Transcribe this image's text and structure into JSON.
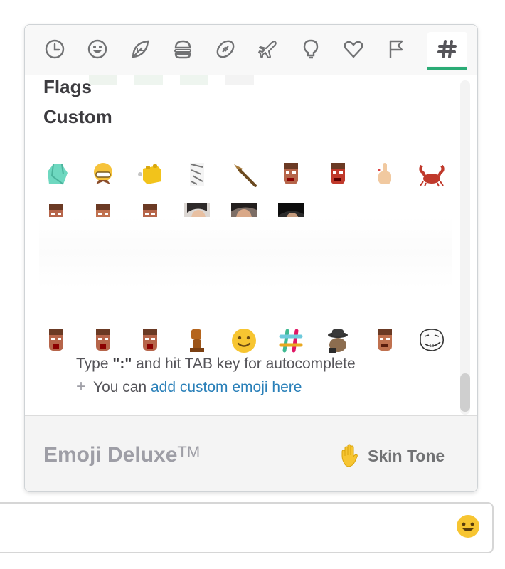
{
  "tabs": [
    {
      "name": "tab-recent",
      "icon": "clock-icon"
    },
    {
      "name": "tab-people",
      "icon": "smiley-icon"
    },
    {
      "name": "tab-nature",
      "icon": "leaf-icon"
    },
    {
      "name": "tab-food",
      "icon": "burger-icon"
    },
    {
      "name": "tab-activity",
      "icon": "football-icon"
    },
    {
      "name": "tab-travel",
      "icon": "airplane-icon"
    },
    {
      "name": "tab-objects",
      "icon": "lightbulb-icon"
    },
    {
      "name": "tab-symbols",
      "icon": "heart-icon"
    },
    {
      "name": "tab-flags",
      "icon": "flag-icon"
    },
    {
      "name": "tab-custom",
      "icon": "slack-hash-icon",
      "active": true
    }
  ],
  "sections": {
    "flags": "Flags",
    "custom": "Custom"
  },
  "emoji_rows": {
    "row1": [
      "gem-stone",
      "grimacing-face",
      "lego-brick",
      "manga-face",
      "broom",
      "doom-face",
      "doom-angry-face",
      "middle-finger",
      "crab"
    ],
    "row2": [
      "doom-scream",
      "doom-grin",
      "doom-ouch",
      "person-photo",
      "person-face-photo",
      "person-dark-photo"
    ],
    "row3": [
      "doom-scream",
      "doom-scream",
      "doom-scream",
      "tiki-figure",
      "smiley",
      "slack-logo",
      "spy-squirrel",
      "doom-face",
      "trollface"
    ]
  },
  "tip": {
    "prefix": "Type ",
    "key": "\":\"",
    "suffix": " and hit TAB key for autocomplete"
  },
  "add_custom": {
    "plus": "+",
    "text": "You can ",
    "link": "add custom emoji here"
  },
  "footer": {
    "title": "Emoji Deluxe",
    "tm": "TM",
    "skin_tone_label": "Skin Tone",
    "skin_tone_icon": "raised-hand-icon"
  },
  "colors": {
    "active_tab_underline": "#2bac76",
    "link": "#2a80b9",
    "footer_title": "#9e9ea6"
  }
}
